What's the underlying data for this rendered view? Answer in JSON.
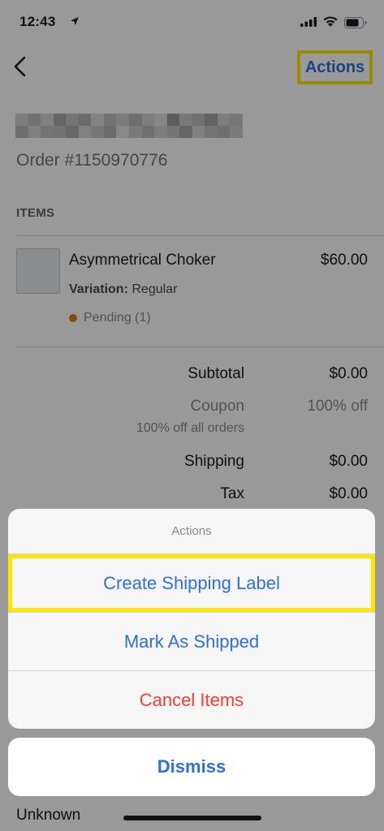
{
  "status_bar": {
    "time": "12:43"
  },
  "nav": {
    "actions_label": "Actions"
  },
  "order": {
    "number": "Order #1150970776"
  },
  "items_section": {
    "label": "ITEMS",
    "item": {
      "name": "Asymmetrical Choker",
      "price": "$60.00",
      "variation_label": "Variation:",
      "variation_value": "Regular",
      "status": "Pending (1)"
    }
  },
  "summary": {
    "subtotal_label": "Subtotal",
    "subtotal_value": "$0.00",
    "coupon_label": "Coupon",
    "coupon_value": "100% off",
    "coupon_note": "100% off all orders",
    "shipping_label": "Shipping",
    "shipping_value": "$0.00",
    "tax_label": "Tax",
    "tax_value": "$0.00"
  },
  "below_sheet_text": "Unknown",
  "action_sheet": {
    "title": "Actions",
    "buttons": [
      "Create Shipping Label",
      "Mark As Shipped",
      "Cancel Items"
    ],
    "dismiss_label": "Dismiss"
  },
  "colors": {
    "accent": "#2f6fd9",
    "destructive": "#ff3b30",
    "highlight": "#ffe600",
    "pending": "#d9830c"
  }
}
